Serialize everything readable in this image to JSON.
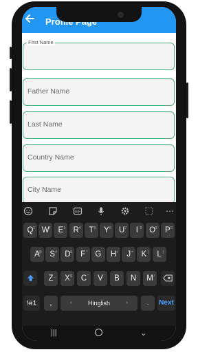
{
  "app_bar": {
    "title": "Profile Page"
  },
  "form": {
    "fields": [
      {
        "label": "First Name",
        "placeholder": ""
      },
      {
        "label": "",
        "placeholder": "Father Name"
      },
      {
        "label": "",
        "placeholder": "Last Name"
      },
      {
        "label": "",
        "placeholder": "Country Name"
      },
      {
        "label": "",
        "placeholder": "City Name"
      }
    ]
  },
  "keyboard": {
    "tool_icons": [
      "emoji-icon",
      "sticker-icon",
      "gif-icon",
      "mic-icon",
      "settings-icon",
      "resize-icon",
      "more-icon"
    ],
    "row1": [
      {
        "k": "Q",
        "n": "1"
      },
      {
        "k": "W",
        "n": "2"
      },
      {
        "k": "E",
        "n": "3"
      },
      {
        "k": "R",
        "n": "4"
      },
      {
        "k": "T",
        "n": "5"
      },
      {
        "k": "Y",
        "n": "6"
      },
      {
        "k": "U",
        "n": "7"
      },
      {
        "k": "I",
        "n": "8"
      },
      {
        "k": "O",
        "n": "9"
      },
      {
        "k": "P",
        "n": "0"
      }
    ],
    "row2": [
      {
        "k": "A",
        "n": "@"
      },
      {
        "k": "S",
        "n": "#"
      },
      {
        "k": "D",
        "n": "&"
      },
      {
        "k": "F",
        "n": "*"
      },
      {
        "k": "G",
        "n": "-"
      },
      {
        "k": "H",
        "n": "+"
      },
      {
        "k": "J",
        "n": "="
      },
      {
        "k": "K",
        "n": "("
      },
      {
        "k": "L",
        "n": ")"
      }
    ],
    "row3": [
      {
        "k": "Z",
        "n": "_"
      },
      {
        "k": "X",
        "n": "$"
      },
      {
        "k": "C",
        "n": "\""
      },
      {
        "k": "V",
        "n": "'"
      },
      {
        "k": "B",
        "n": ":"
      },
      {
        "k": "N",
        "n": ";"
      },
      {
        "k": "M",
        "n": "/"
      }
    ],
    "symbols_label": "!#1",
    "comma_label": ",",
    "space_label": "Hinglish",
    "period_label": ".",
    "next_label": "Next",
    "shift_icon": "shift-icon",
    "backspace_icon": "backspace-icon"
  },
  "colors": {
    "app_bar": "#2196f3",
    "field_border": "#4caf7d",
    "keyboard_bg": "#1c1c1c",
    "key_bg": "#3a3a3a",
    "next_blue": "#4a9cff"
  }
}
